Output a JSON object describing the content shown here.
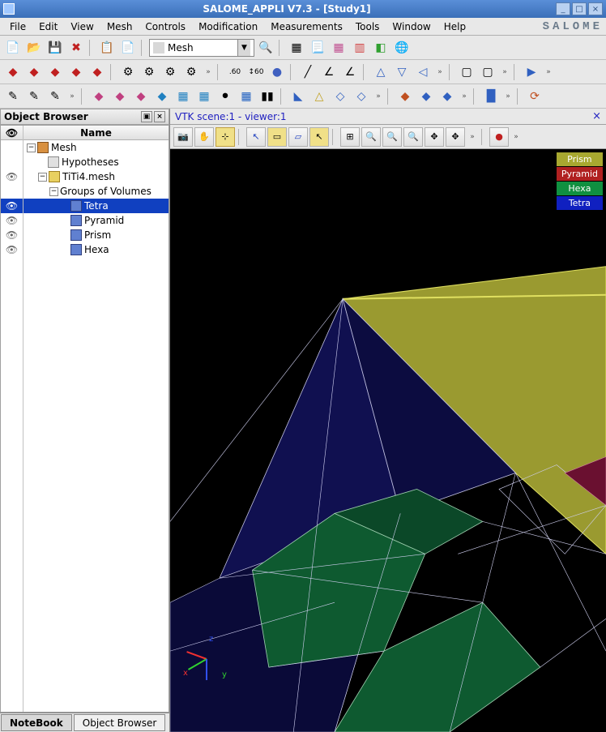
{
  "window": {
    "title": "SALOME_APPLI V7.3 - [Study1]"
  },
  "menu": {
    "items": [
      "File",
      "Edit",
      "View",
      "Mesh",
      "Controls",
      "Modification",
      "Measurements",
      "Tools",
      "Window",
      "Help"
    ],
    "brand": "SALOME"
  },
  "toolbar1": {
    "combo": "Mesh"
  },
  "objectBrowser": {
    "title": "Object Browser",
    "eyeHeader": "👁",
    "nameHeader": "Name",
    "tree": {
      "root": "Mesh",
      "hyp": "Hypotheses",
      "file": "TiTi4.mesh",
      "grp": "Groups of Volumes",
      "items": [
        "Tetra",
        "Pyramid",
        "Prism",
        "Hexa"
      ],
      "selected": 0
    }
  },
  "bottomTabs": {
    "items": [
      "NoteBook",
      "Object Browser"
    ],
    "active": 0
  },
  "viewer": {
    "title": "VTK scene:1 - viewer:1"
  },
  "legend": {
    "items": [
      {
        "label": "Prism",
        "bg": "#a8a830"
      },
      {
        "label": "Pyramid",
        "bg": "#b02020"
      },
      {
        "label": "Hexa",
        "bg": "#109040"
      },
      {
        "label": "Tetra",
        "bg": "#1020c0"
      }
    ]
  },
  "axis": {
    "x": "x",
    "y": "y",
    "z": "z"
  }
}
